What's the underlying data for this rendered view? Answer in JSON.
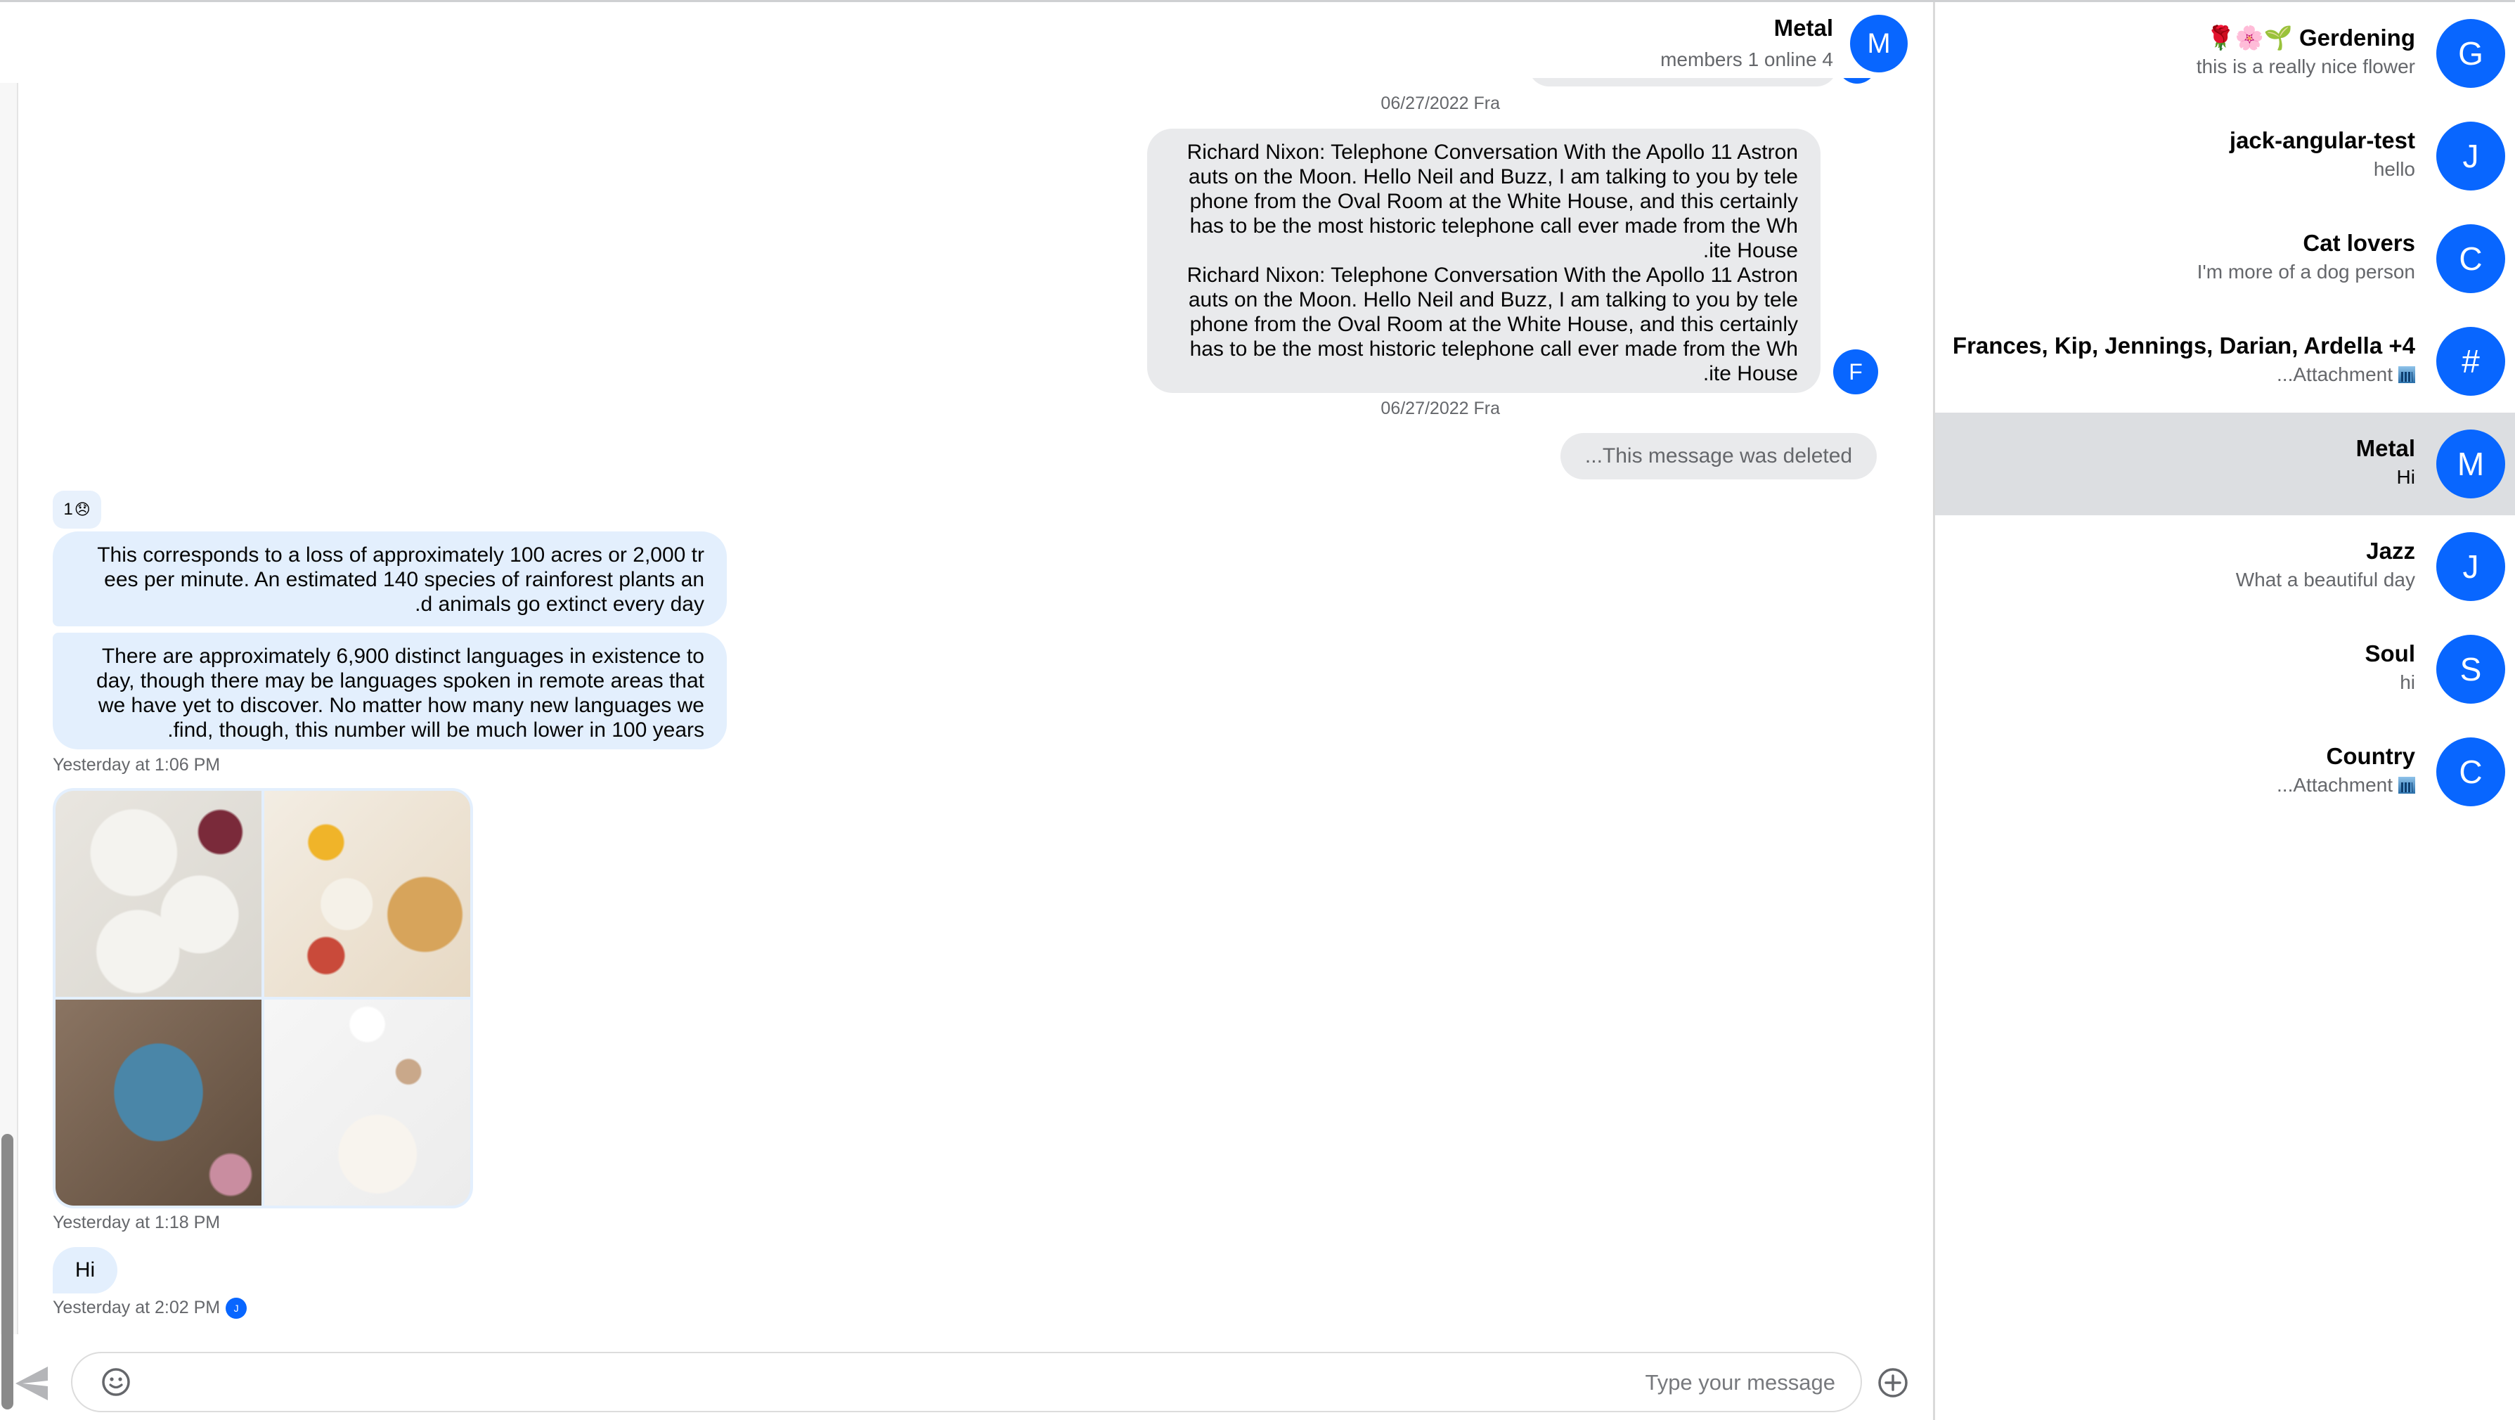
{
  "header": {
    "title": "Metal",
    "subtitle": "members 1 online 4",
    "avatar_letter": "M"
  },
  "messages": {
    "top_timestamp": "06/27/2022 Fra",
    "outgoing_long": {
      "paragraphs": [
        "Richard Nixon: Telephone Conversation With the Apollo 11 Astronauts on the Moon. Hello Neil and Buzz, I am talking to you by telephone from the Oval Room at the White House, and this certainly has to be the most historic telephone call ever made from the White House.",
        "Richard Nixon: Telephone Conversation With the Apollo 11 Astronauts on the Moon. Hello Neil and Buzz, I am talking to you by telephone from the Oval Room at the White House, and this certainly has to be the most historic telephone call ever made from the White House."
      ],
      "lines": [
        "Richard Nixon: Telephone Conversation With the Apollo 11 Astron",
        "auts on the Moon. Hello Neil and Buzz, I am talking to you by tele",
        "phone from the Oval Room at the White House, and this certainly",
        "has to be the most historic telephone call ever made from the Wh",
        ".ite House",
        "Richard Nixon: Telephone Conversation With the Apollo 11 Astron",
        "auts on the Moon. Hello Neil and Buzz, I am talking to you by tele",
        "phone from the Oval Room at the White House, and this certainly",
        "has to be the most historic telephone call ever made from the Wh",
        ".ite House"
      ],
      "sender_initial": "F",
      "timestamp": "06/27/2022 Fra"
    },
    "deleted_text": "...This message was deleted",
    "reaction": {
      "count": "1",
      "emoji": "😞"
    },
    "incoming_1": {
      "lines": [
        "This corresponds to a loss of approximately 100 acres or 2,000 tr",
        "ees per minute. An estimated 140 species of rainforest plants an",
        ".d animals go extinct every day"
      ]
    },
    "incoming_2": {
      "lines": [
        "There are approximately 6,900 distinct languages in existence to",
        "day, though there may be languages spoken in remote areas that",
        "we have yet to discover. No matter how many new languages we",
        ".find, though, this number will be much lower in 100 years"
      ],
      "timestamp": "Yesterday at 1:06 PM"
    },
    "image_attachment": {
      "images": [
        "pasta-dishes",
        "breakfast-waffles",
        "salad-bowl",
        "fruit-bowl-coffee"
      ],
      "timestamp": "Yesterday at 1:18 PM"
    },
    "hi_message": {
      "text": "Hi",
      "timestamp": "Yesterday at 2:02 PM",
      "seen_by_initial": "J"
    }
  },
  "composer": {
    "placeholder": "Type your message",
    "value": "",
    "send_icon": "send-icon",
    "emoji_icon": "smiley-icon",
    "attach_icon": "plus-circle-icon"
  },
  "sidebar": {
    "conversations": [
      {
        "name": "🌹🌸🌱 Gerdening",
        "last_message": "this is a really nice flower",
        "avatar": "G",
        "attachment": false,
        "active": false
      },
      {
        "name": "jack-angular-test",
        "last_message": "hello",
        "avatar": "J",
        "attachment": false,
        "active": false
      },
      {
        "name": "Cat lovers",
        "last_message": "I'm more of a dog person",
        "avatar": "C",
        "attachment": false,
        "active": false
      },
      {
        "name": "Frances, Kip, Jennings, Darian, Ardella +4",
        "last_message": "...Attachment",
        "avatar": "#",
        "attachment": true,
        "active": false
      },
      {
        "name": "Metal",
        "last_message": "Hi",
        "avatar": "M",
        "attachment": false,
        "active": true
      },
      {
        "name": "Jazz",
        "last_message": "What a beautiful day",
        "avatar": "J",
        "attachment": false,
        "active": false
      },
      {
        "name": "Soul",
        "last_message": "hi",
        "avatar": "S",
        "attachment": false,
        "active": false
      },
      {
        "name": "Country",
        "last_message": "...Attachment",
        "avatar": "C",
        "attachment": true,
        "active": false
      }
    ]
  },
  "colors": {
    "accent": "#0866ff",
    "incoming_bubble": "#e3effd",
    "outgoing_bubble": "#e9eaec",
    "active_conversation": "#dcdee1",
    "secondary_text": "#65676b"
  }
}
